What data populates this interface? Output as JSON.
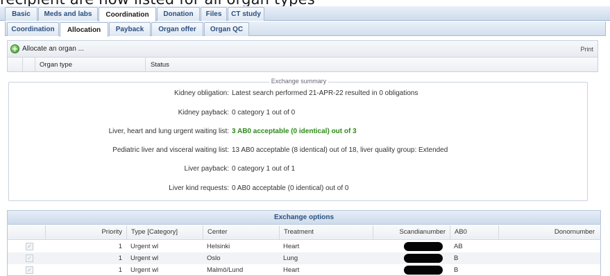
{
  "caption": "recipient are now listed for all organ types",
  "main_tabs": [
    "Basic",
    "Meds and labs",
    "Coordination",
    "Donation",
    "Files",
    "CT study"
  ],
  "main_tabs_active": "Coordination",
  "sub_tabs": [
    "Coordination",
    "Allocation",
    "Payback",
    "Organ offer",
    "Organ QC"
  ],
  "sub_tabs_active": "Allocation",
  "allocate": {
    "action_label": "Allocate an organ ...",
    "print_label": "Print",
    "columns": [
      "Organ type",
      "Status"
    ]
  },
  "summary": {
    "legend": "Exchange summary",
    "rows": [
      {
        "label": "Kidney obligation:",
        "value": "Latest search performed 21-APR-22 resulted in 0 obligations"
      },
      {
        "label": "Kidney payback:",
        "value": "0 category 1 out of 0"
      },
      {
        "label": "Liver, heart and lung urgent waiting list:",
        "value": "3 AB0 acceptable (0 identical) out of 3"
      },
      {
        "label": "Pediatric liver and visceral waiting list:",
        "value": "13 AB0 acceptable (8 identical) out of 18, liver quality group: Extended"
      },
      {
        "label": "Liver payback:",
        "value": "0 category 1 out of 1"
      },
      {
        "label": "Liver kind requests:",
        "value": "0 AB0 acceptable (0 identical) out of 0"
      }
    ],
    "highlight_color": "#2e8b19"
  },
  "options": {
    "title": "Exchange options",
    "columns": [
      "Priority",
      "Type [Category]",
      "Center",
      "Treatment",
      "Scandianumber",
      "AB0",
      "Donornumber"
    ],
    "rows": [
      {
        "priority": "1",
        "type": "Urgent wl",
        "center": "Helsinki",
        "treatment": "Heart",
        "ab0": "AB"
      },
      {
        "priority": "1",
        "type": "Urgent wl",
        "center": "Oslo",
        "treatment": "Lung",
        "ab0": "B"
      },
      {
        "priority": "1",
        "type": "Urgent wl",
        "center": "Malmö/Lund",
        "treatment": "Heart",
        "ab0": "B"
      }
    ]
  }
}
